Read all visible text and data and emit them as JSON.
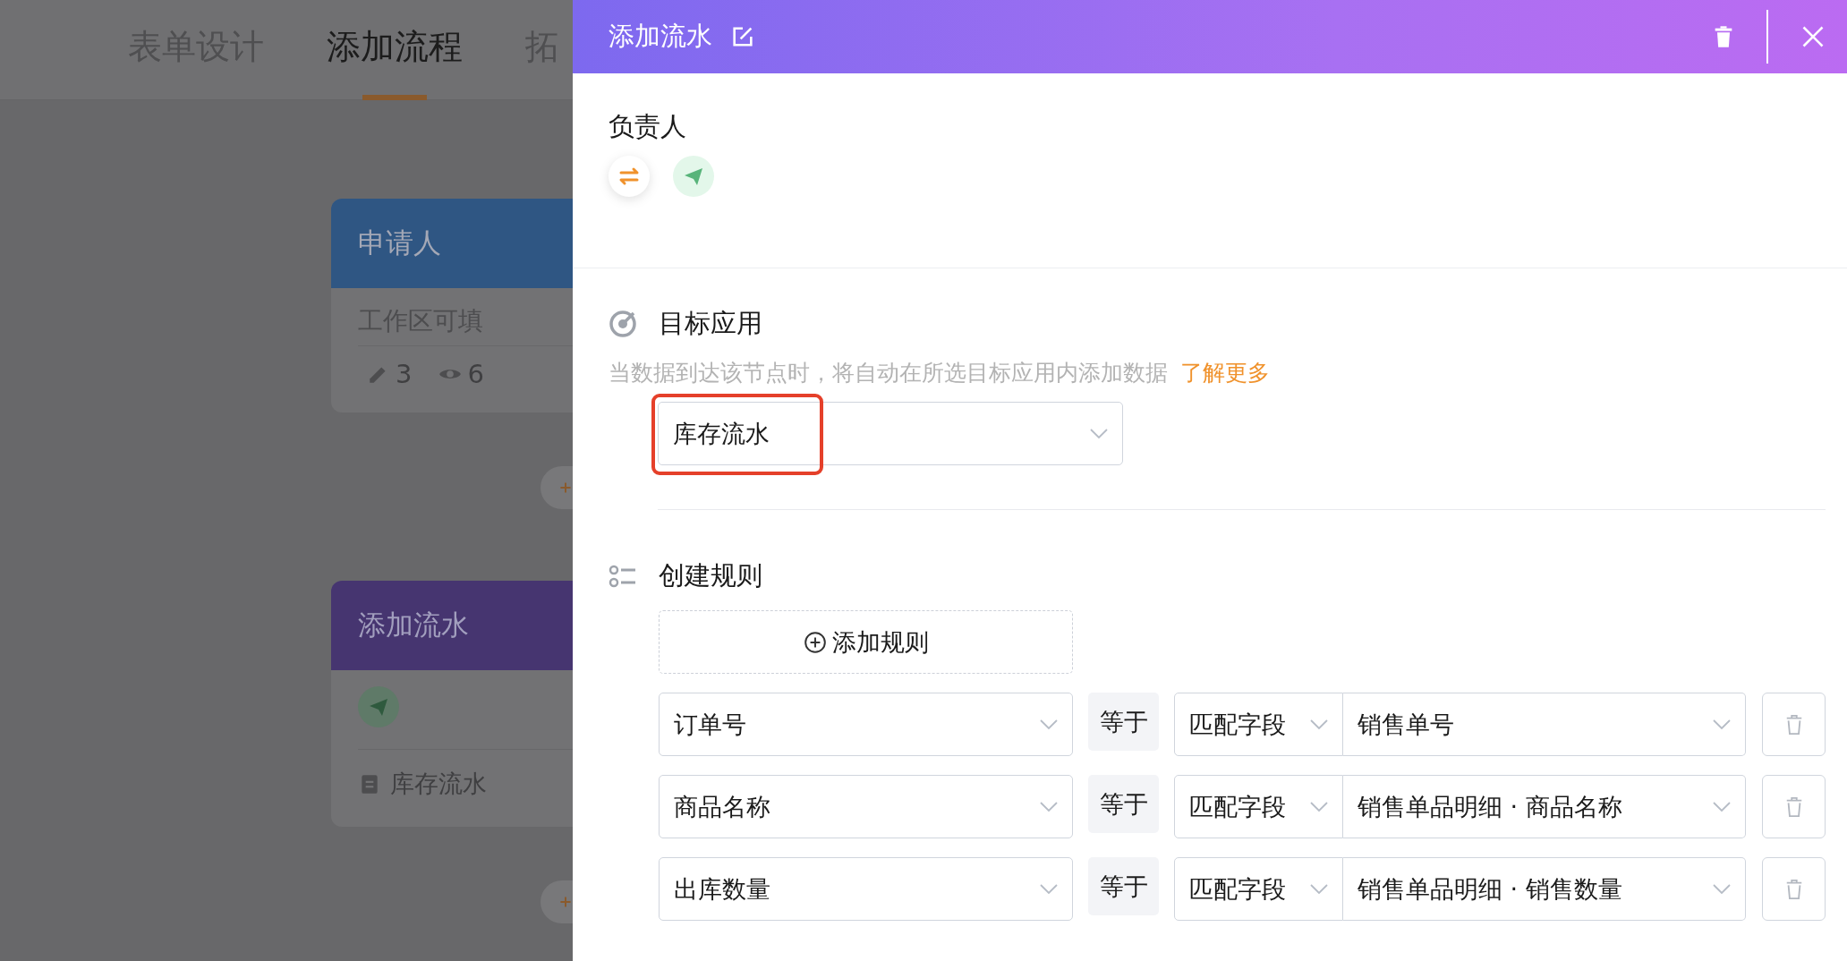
{
  "background": {
    "tabs": [
      {
        "label": "表单设计",
        "selected": false
      },
      {
        "label": "添加流程",
        "selected": true
      },
      {
        "label": "拓",
        "selected": false
      }
    ],
    "nodes": [
      {
        "kind": "applicant",
        "title": "申请人",
        "subtitle": "工作区可填",
        "edit_count": "3",
        "view_count": "6"
      },
      {
        "kind": "add_record",
        "title": "添加流水",
        "target": "库存流水"
      }
    ]
  },
  "panel": {
    "title": "添加流水",
    "owner": {
      "label": "负责人"
    },
    "target_app": {
      "heading": "目标应用",
      "description": "当数据到达该节点时，将自动在所选目标应用内添加数据",
      "link": "了解更多",
      "value": "库存流水",
      "highlighted": true
    },
    "rules": {
      "heading": "创建规则",
      "add_button": "添加规则",
      "rows": [
        {
          "field": "订单号",
          "operator": "等于",
          "mode": "匹配字段",
          "value": "销售单号"
        },
        {
          "field": "商品名称",
          "operator": "等于",
          "mode": "匹配字段",
          "value": "销售单品明细 · 商品名称"
        },
        {
          "field": "出库数量",
          "operator": "等于",
          "mode": "匹配字段",
          "value": "销售单品明细 · 销售数量"
        }
      ]
    }
  }
}
